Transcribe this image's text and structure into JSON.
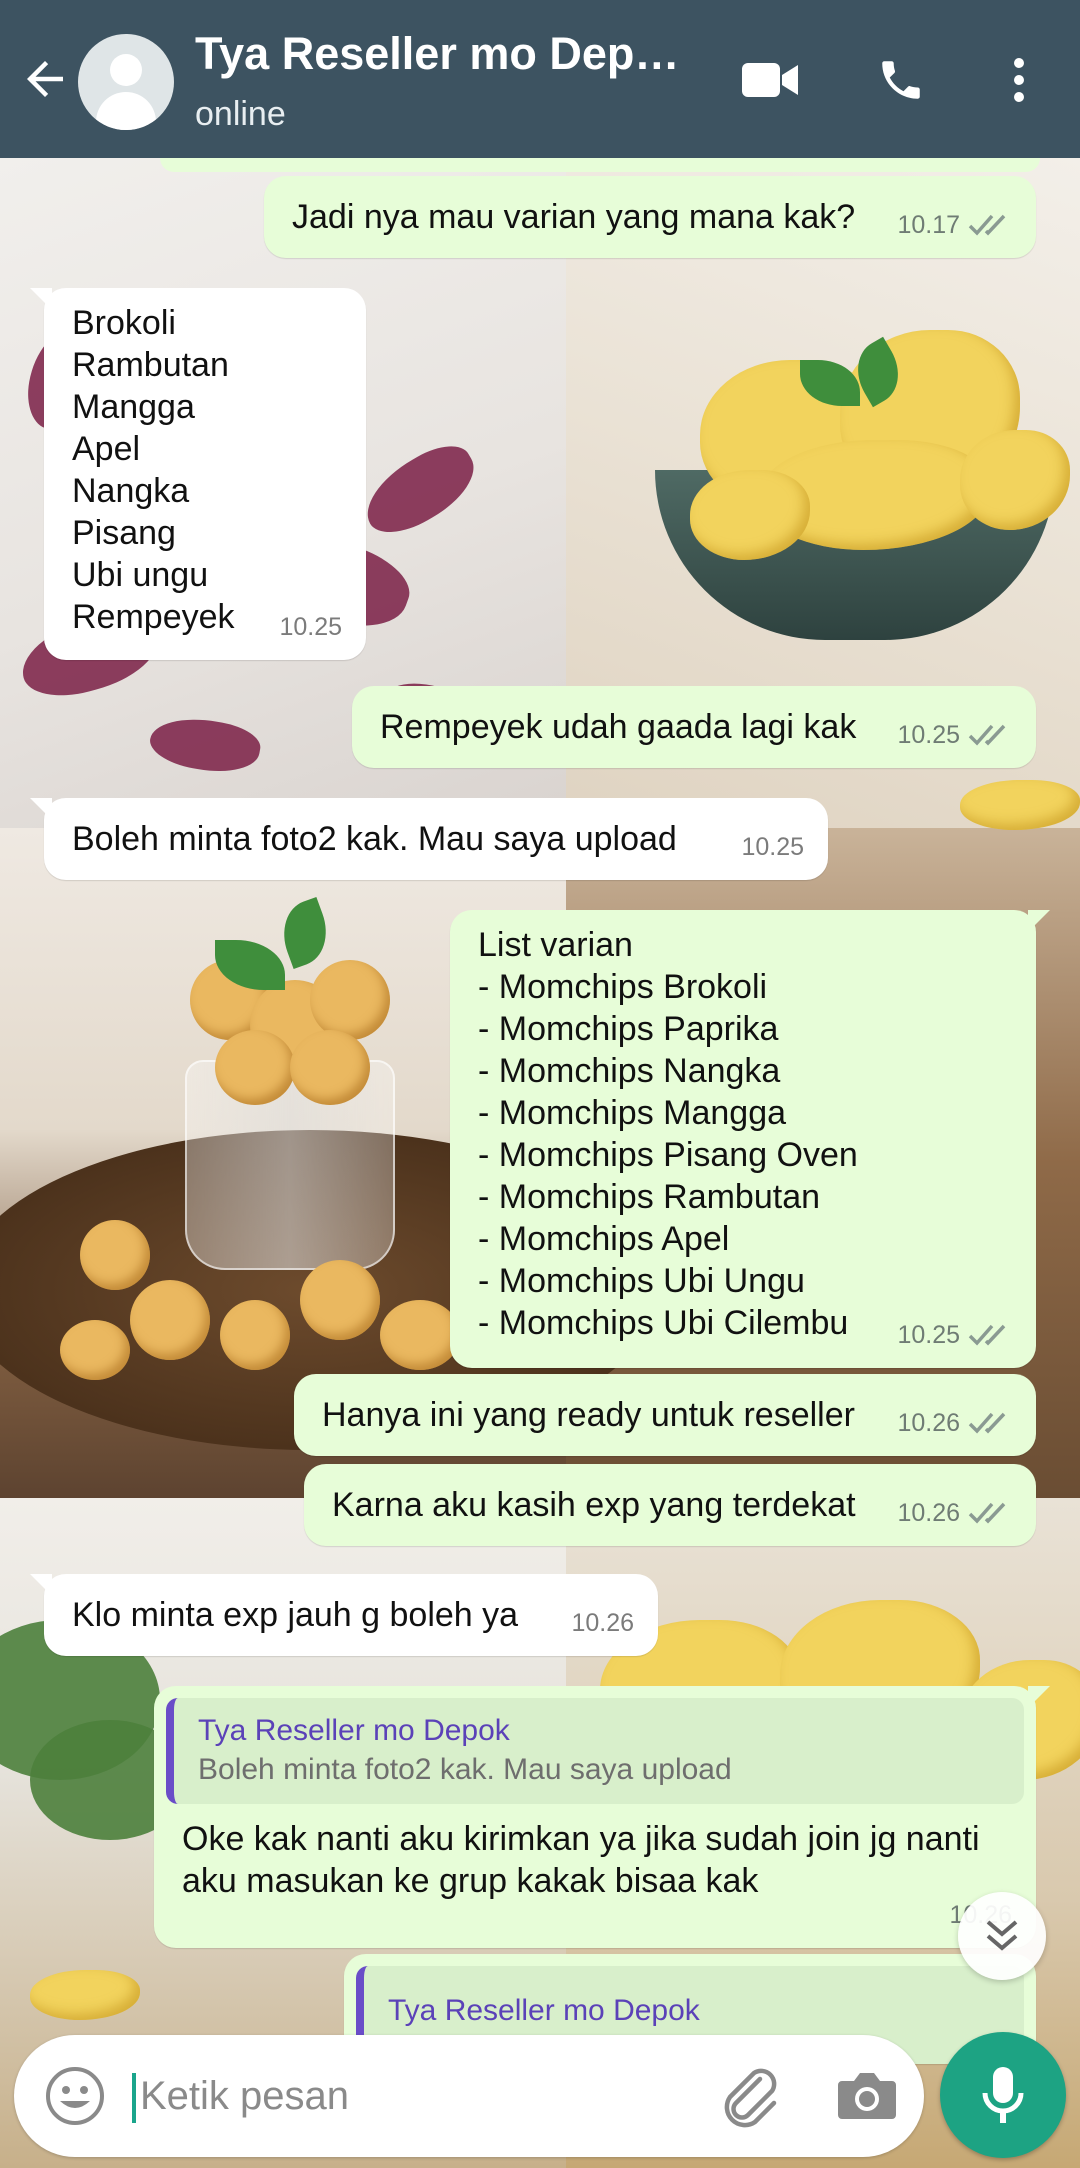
{
  "header": {
    "title": "Tya Reseller mo Dep…",
    "status": "online"
  },
  "messages": [
    {
      "text": "Jadi nya mau varian yang mana kak?",
      "time": "10.17"
    },
    {
      "text": "Brokoli\nRambutan\nMangga\nApel\nNangka\nPisang\nUbi ungu\nRempeyek",
      "time": "10.25"
    },
    {
      "text": "Rempeyek udah gaada lagi kak",
      "time": "10.25"
    },
    {
      "text": "Boleh minta foto2 kak. Mau saya upload",
      "time": "10.25"
    },
    {
      "text": "List varian\n- Momchips Brokoli\n- Momchips Paprika\n- Momchips Nangka\n- Momchips Mangga\n- Momchips Pisang Oven\n- Momchips Rambutan\n- Momchips Apel\n- Momchips Ubi Ungu\n- Momchips Ubi Cilembu",
      "time": "10.25"
    },
    {
      "text": "Hanya ini yang ready untuk reseller",
      "time": "10.26"
    },
    {
      "text": "Karna aku kasih exp yang terdekat",
      "time": "10.26"
    },
    {
      "text": "Klo minta exp jauh g boleh ya",
      "time": "10.26"
    },
    {
      "quote_name": "Tya Reseller mo Depok",
      "quote_text": "Boleh minta foto2 kak. Mau saya upload",
      "text": "Oke kak nanti aku kirimkan ya jika sudah join jg nanti aku masukan ke grup kakak bisaa kak",
      "time": "10.26"
    },
    {
      "quote_name": "Tya Reseller mo Depok"
    }
  ],
  "composer": {
    "placeholder": "Ketik pesan"
  },
  "colors": {
    "header": "#3d5361",
    "outgoing_bubble": "#e7fdd8",
    "incoming_bubble": "#ffffff",
    "accent": "#1da383",
    "quote_name": "#5b42b8"
  },
  "icons": [
    "back-arrow-icon",
    "avatar-icon",
    "video-call-icon",
    "phone-icon",
    "more-options-icon",
    "double-check-icon",
    "scroll-down-icon",
    "emoji-icon",
    "attach-icon",
    "camera-icon",
    "mic-icon"
  ]
}
